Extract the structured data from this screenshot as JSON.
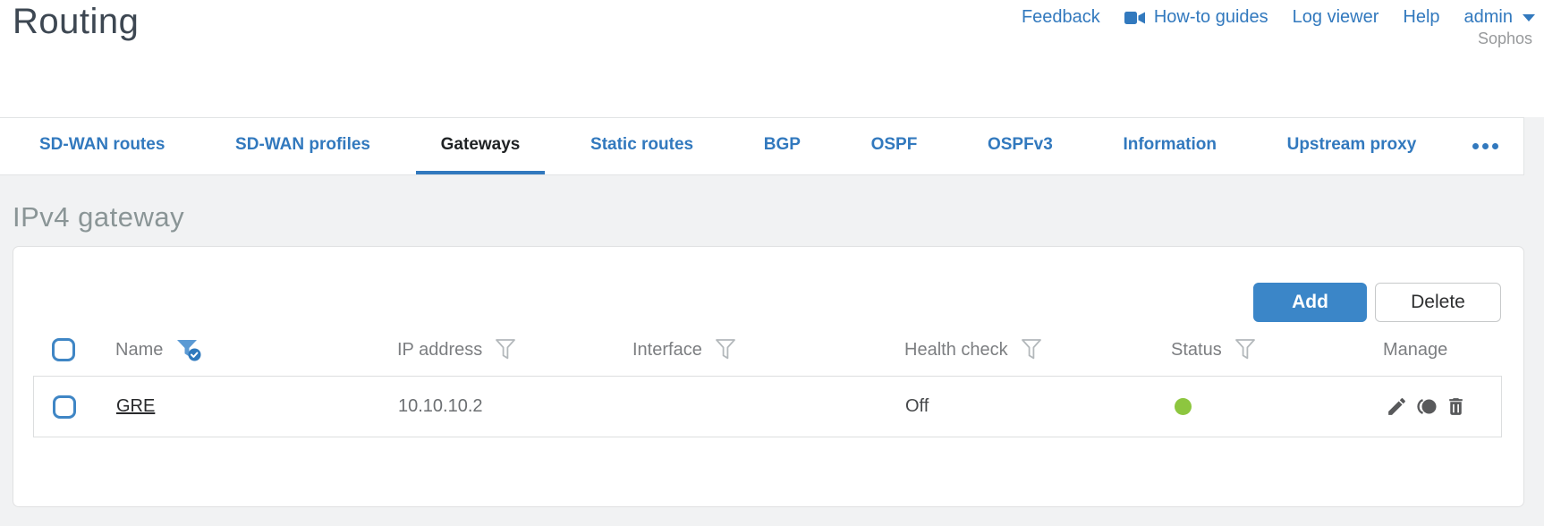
{
  "header": {
    "title": "Routing",
    "brand": "Sophos",
    "nav": [
      {
        "label": "Feedback",
        "icon": null
      },
      {
        "label": "How-to guides",
        "icon": "video-camera-icon"
      },
      {
        "label": "Log viewer",
        "icon": null
      },
      {
        "label": "Help",
        "icon": null
      },
      {
        "label": "admin",
        "icon": "caret-down-icon"
      }
    ]
  },
  "tabs": {
    "items": [
      {
        "label": "SD-WAN routes",
        "active": false
      },
      {
        "label": "SD-WAN profiles",
        "active": false
      },
      {
        "label": "Gateways",
        "active": true
      },
      {
        "label": "Static routes",
        "active": false
      },
      {
        "label": "BGP",
        "active": false
      },
      {
        "label": "OSPF",
        "active": false
      },
      {
        "label": "OSPFv3",
        "active": false
      },
      {
        "label": "Information",
        "active": false
      },
      {
        "label": "Upstream proxy",
        "active": false
      }
    ],
    "overflow_icon": "ellipsis"
  },
  "section": {
    "heading": "IPv4 gateway"
  },
  "toolbar": {
    "add_label": "Add",
    "delete_label": "Delete"
  },
  "table": {
    "columns": [
      {
        "label": "Name",
        "filter": "active"
      },
      {
        "label": "IP address",
        "filter": "inactive"
      },
      {
        "label": "Interface",
        "filter": "inactive"
      },
      {
        "label": "Health check",
        "filter": "inactive"
      },
      {
        "label": "Status",
        "filter": "inactive"
      },
      {
        "label": "Manage",
        "filter": null
      }
    ],
    "rows": [
      {
        "name": "GRE",
        "ip_address": "10.10.10.2",
        "interface": "",
        "health_check": "Off",
        "status": "green",
        "actions": [
          "edit",
          "clone",
          "delete"
        ]
      }
    ]
  },
  "colors": {
    "accent_blue": "#3279be",
    "button_blue": "#3b86c8",
    "status_green": "#8dc63f"
  }
}
